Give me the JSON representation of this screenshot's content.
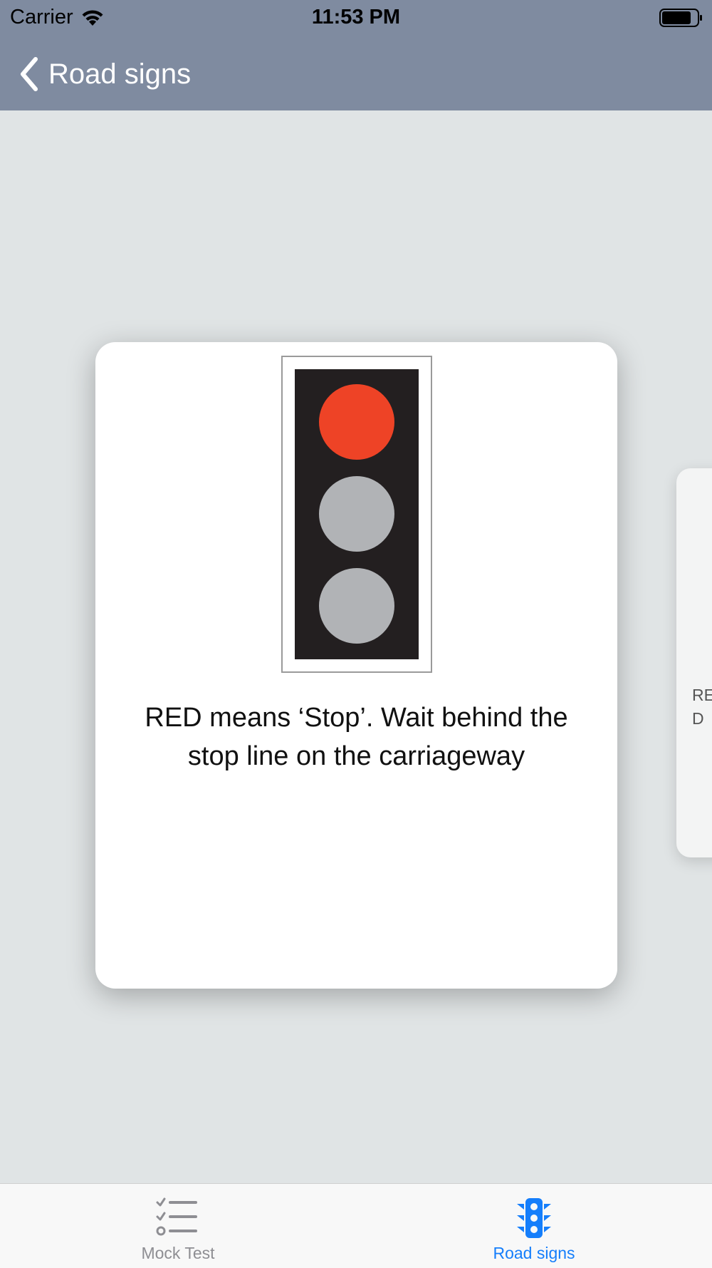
{
  "status_bar": {
    "carrier": "Carrier",
    "time": "11:53 PM",
    "icons": [
      "wifi-icon",
      "battery-icon"
    ]
  },
  "nav": {
    "back_label": "Road signs",
    "background_color": "#7f8ba0"
  },
  "cards": [
    {
      "caption": "RED means ‘Stop’. Wait behind the stop line on the carriageway",
      "image": "traffic-light-red-icon",
      "lights": [
        "red",
        "off",
        "off"
      ],
      "colors": {
        "red": "#ee4326",
        "off": "#b1b3b6",
        "housing": "#231f20"
      }
    },
    {
      "caption": "RE\nD",
      "partial": true
    }
  ],
  "tabs": [
    {
      "label": "Mock Test",
      "icon": "checklist-icon",
      "selected": false
    },
    {
      "label": "Road signs",
      "icon": "traffic-light-icon",
      "selected": true
    }
  ],
  "colors": {
    "accent": "#157efb",
    "inactive": "#8e8e93",
    "content_bg": "#e0e4e5"
  }
}
